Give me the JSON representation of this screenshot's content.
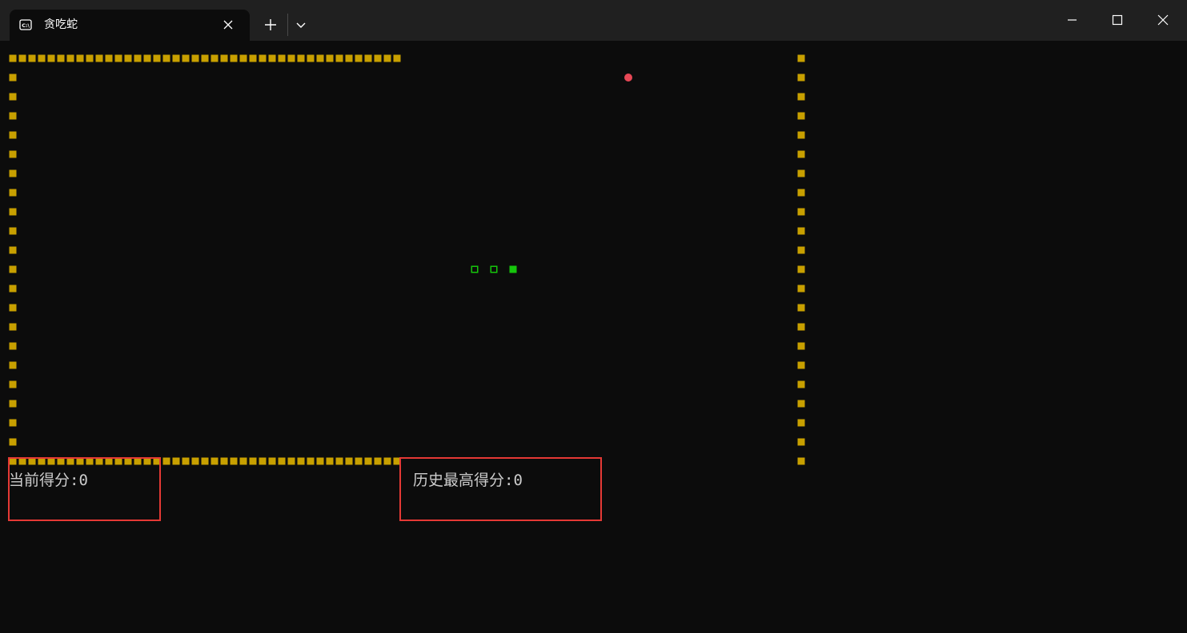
{
  "window": {
    "tab_title": "贪吃蛇",
    "tab_icon": "console-icon",
    "new_tab_icon": "plus-icon",
    "dropdown_icon": "chevron-down-icon",
    "minimize_icon": "minimize-icon",
    "maximize_icon": "maximize-icon",
    "close_icon": "close-icon"
  },
  "game": {
    "current_score_label": "当前得分:",
    "current_score": "0",
    "best_score_label": "历史最高得分:",
    "best_score": "0",
    "wall_color": "#c8a000",
    "snake_color": "#16c60c",
    "food_color": "#e74856",
    "highlight_color": "#e53935",
    "wall_glyph": "■",
    "snake_head_glyph": "■",
    "snake_body_glyph": "□",
    "food_glyph": "●",
    "snake_direction": "right"
  }
}
